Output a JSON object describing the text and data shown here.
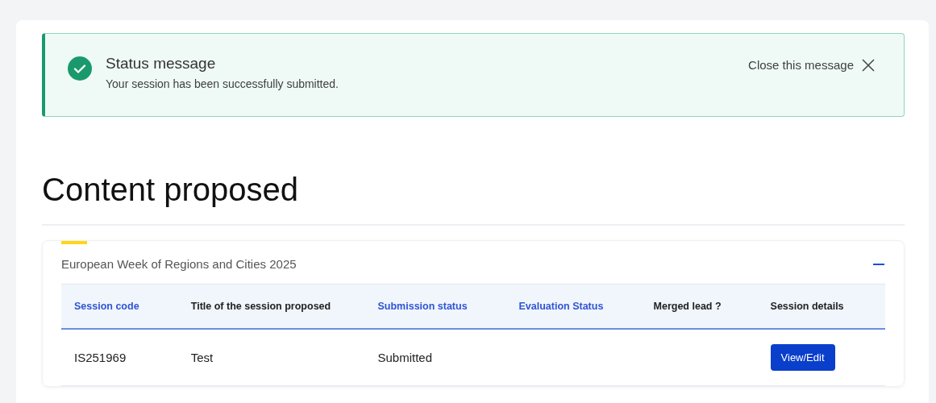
{
  "alert": {
    "title": "Status message",
    "text": "Your session has been successfully submitted.",
    "close_label": "Close this message"
  },
  "heading": "Content proposed",
  "accordion": {
    "title": "European Week of Regions and Cities 2025",
    "expanded": true,
    "table": {
      "columns": [
        {
          "label": "Session code",
          "sortable": true
        },
        {
          "label": "Title of the session proposed",
          "sortable": false
        },
        {
          "label": "Submission status",
          "sortable": true
        },
        {
          "label": "Evaluation Status",
          "sortable": true
        },
        {
          "label": "Merged lead ?",
          "sortable": false
        },
        {
          "label": "Session details",
          "sortable": false
        }
      ],
      "rows": [
        {
          "cells": [
            {
              "kind": "text",
              "text": "IS251969"
            },
            {
              "kind": "text",
              "text": "Test"
            },
            {
              "kind": "text",
              "text": "Submitted"
            },
            {
              "kind": "text",
              "text": ""
            },
            {
              "kind": "text",
              "text": ""
            },
            {
              "kind": "button",
              "text": "View/Edit"
            }
          ]
        }
      ]
    }
  }
}
